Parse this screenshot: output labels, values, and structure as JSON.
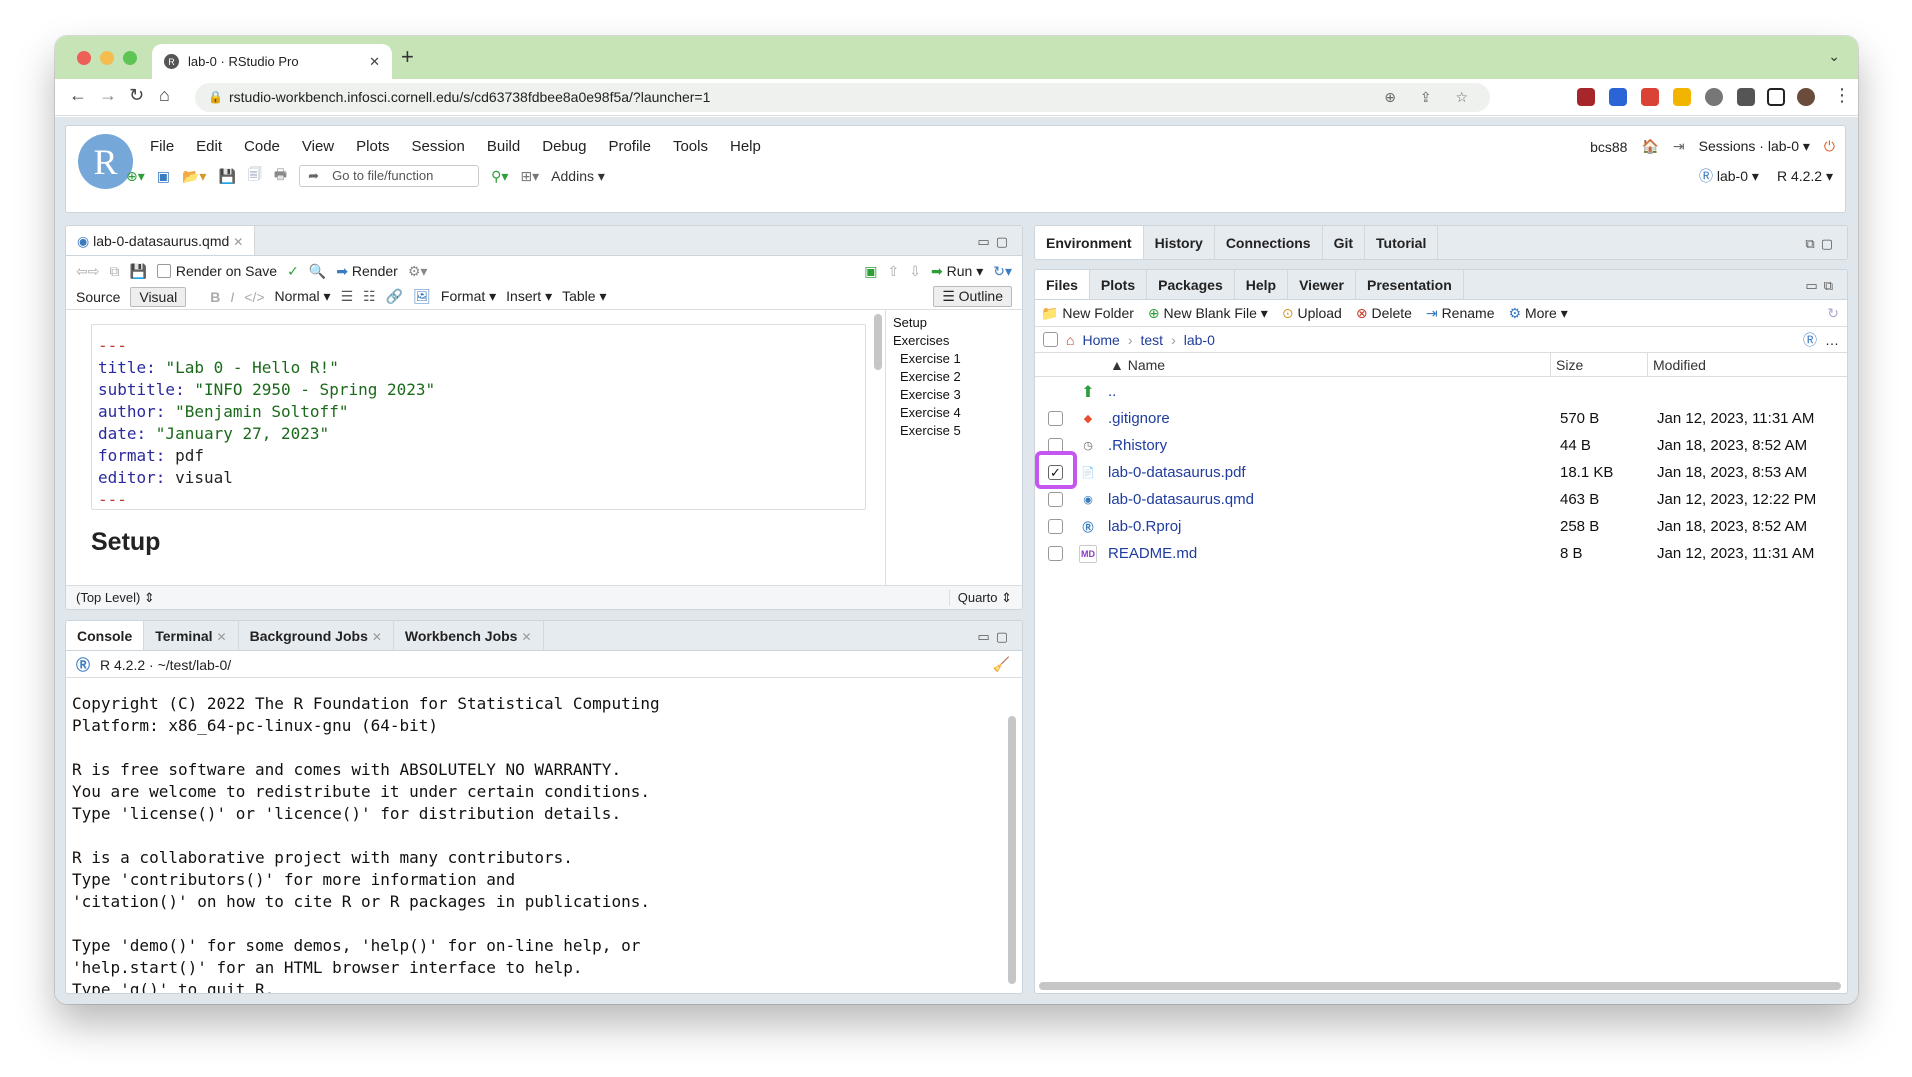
{
  "browser": {
    "tab_title": "lab-0 · RStudio Pro",
    "url": "rstudio-workbench.infosci.cornell.edu/s/cd63738fdbee8a0e98f5a/?launcher=1"
  },
  "menu": {
    "items": [
      "File",
      "Edit",
      "Code",
      "View",
      "Plots",
      "Session",
      "Build",
      "Debug",
      "Profile",
      "Tools",
      "Help"
    ],
    "user": "bcs88",
    "sessions": "Sessions · lab-0",
    "goto_placeholder": "Go to file/function",
    "addins": "Addins",
    "project": "lab-0",
    "r_version": "R 4.2.2"
  },
  "editor": {
    "tab": "lab-0-datasaurus.qmd",
    "render_on_save": "Render on Save",
    "render": "Render",
    "run": "Run",
    "source": "Source",
    "visual": "Visual",
    "normal": "Normal",
    "format": "Format",
    "insert": "Insert",
    "table": "Table",
    "outline_btn": "Outline",
    "yaml": [
      {
        "k": "title",
        "v": "\"Lab 0 - Hello R!\""
      },
      {
        "k": "subtitle",
        "v": "\"INFO 2950 - Spring 2023\""
      },
      {
        "k": "author",
        "v": "\"Benjamin Soltoff\""
      },
      {
        "k": "date",
        "v": "\"January 27, 2023\""
      },
      {
        "k": "format",
        "v": "pdf"
      },
      {
        "k": "editor",
        "v": "visual"
      }
    ],
    "dashes": "---",
    "heading": "Setup",
    "status_left": "(Top Level)",
    "status_right": "Quarto",
    "outline": [
      "Setup",
      "Exercises",
      "Exercise 1",
      "Exercise 2",
      "Exercise 3",
      "Exercise 4",
      "Exercise 5"
    ]
  },
  "console": {
    "tabs": [
      "Console",
      "Terminal",
      "Background Jobs",
      "Workbench Jobs"
    ],
    "header": "R 4.2.2 · ~/test/lab-0/",
    "lines": [
      "Copyright (C) 2022 The R Foundation for Statistical Computing",
      "Platform: x86_64-pc-linux-gnu (64-bit)",
      "",
      "R is free software and comes with ABSOLUTELY NO WARRANTY.",
      "You are welcome to redistribute it under certain conditions.",
      "Type 'license()' or 'licence()' for distribution details.",
      "",
      "R is a collaborative project with many contributors.",
      "Type 'contributors()' for more information and",
      "'citation()' on how to cite R or R packages in publications.",
      "",
      "Type 'demo()' for some demos, 'help()' for on-line help, or",
      "'help.start()' for an HTML browser interface to help.",
      "Type 'q()' to quit R.",
      "",
      "> "
    ]
  },
  "env": {
    "tabs": [
      "Environment",
      "History",
      "Connections",
      "Git",
      "Tutorial"
    ]
  },
  "files": {
    "tabs": [
      "Files",
      "Plots",
      "Packages",
      "Help",
      "Viewer",
      "Presentation"
    ],
    "toolbar": [
      "New Folder",
      "New Blank File",
      "Upload",
      "Delete",
      "Rename",
      "More"
    ],
    "breadcrumb": [
      "Home",
      "test",
      "lab-0"
    ],
    "col_name": "Name",
    "col_size": "Size",
    "col_modified": "Modified",
    "up": "..",
    "rows": [
      {
        "name": ".gitignore",
        "size": "570 B",
        "mod": "Jan 12, 2023, 11:31 AM",
        "icon": "git-icon",
        "checked": false
      },
      {
        "name": ".Rhistory",
        "size": "44 B",
        "mod": "Jan 18, 2023, 8:52 AM",
        "icon": "history-icon",
        "checked": false
      },
      {
        "name": "lab-0-datasaurus.pdf",
        "size": "18.1 KB",
        "mod": "Jan 18, 2023, 8:53 AM",
        "icon": "pdf-icon",
        "checked": true
      },
      {
        "name": "lab-0-datasaurus.qmd",
        "size": "463 B",
        "mod": "Jan 12, 2023, 12:22 PM",
        "icon": "quarto-icon",
        "checked": false
      },
      {
        "name": "lab-0.Rproj",
        "size": "258 B",
        "mod": "Jan 18, 2023, 8:52 AM",
        "icon": "rproj-icon",
        "checked": false
      },
      {
        "name": "README.md",
        "size": "8 B",
        "mod": "Jan 12, 2023, 11:31 AM",
        "icon": "md-icon",
        "checked": false
      }
    ]
  }
}
